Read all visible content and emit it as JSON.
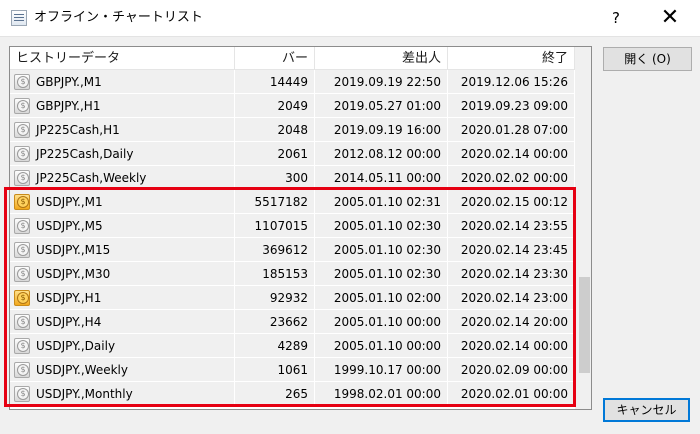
{
  "window": {
    "title": "オフライン・チャートリスト",
    "help": "?",
    "close": "✕"
  },
  "table": {
    "columns": [
      "ヒストリーデータ",
      "バー",
      "差出人",
      "終了"
    ],
    "rows": [
      {
        "symbol": "GBPJPY.,M1",
        "bars": "14449",
        "from": "2019.09.19 22:50",
        "to": "2019.12.06 15:26",
        "icon": "chart-icon"
      },
      {
        "symbol": "GBPJPY.,H1",
        "bars": "2049",
        "from": "2019.05.27 01:00",
        "to": "2019.09.23 09:00",
        "icon": "chart-icon"
      },
      {
        "symbol": "JP225Cash,H1",
        "bars": "2048",
        "from": "2019.09.19 16:00",
        "to": "2020.01.28 07:00",
        "icon": "chart-icon"
      },
      {
        "symbol": "JP225Cash,Daily",
        "bars": "2061",
        "from": "2012.08.12 00:00",
        "to": "2020.02.14 00:00",
        "icon": "chart-icon"
      },
      {
        "symbol": "JP225Cash,Weekly",
        "bars": "300",
        "from": "2014.05.11 00:00",
        "to": "2020.02.02 00:00",
        "icon": "chart-icon"
      },
      {
        "symbol": "USDJPY.,M1",
        "bars": "5517182",
        "from": "2005.01.10 02:31",
        "to": "2020.02.15 00:12",
        "icon": "chart-icon-gold"
      },
      {
        "symbol": "USDJPY.,M5",
        "bars": "1107015",
        "from": "2005.01.10 02:30",
        "to": "2020.02.14 23:55",
        "icon": "chart-icon"
      },
      {
        "symbol": "USDJPY.,M15",
        "bars": "369612",
        "from": "2005.01.10 02:30",
        "to": "2020.02.14 23:45",
        "icon": "chart-icon"
      },
      {
        "symbol": "USDJPY.,M30",
        "bars": "185153",
        "from": "2005.01.10 02:30",
        "to": "2020.02.14 23:30",
        "icon": "chart-icon"
      },
      {
        "symbol": "USDJPY.,H1",
        "bars": "92932",
        "from": "2005.01.10 02:00",
        "to": "2020.02.14 23:00",
        "icon": "chart-icon-gold"
      },
      {
        "symbol": "USDJPY.,H4",
        "bars": "23662",
        "from": "2005.01.10 00:00",
        "to": "2020.02.14 20:00",
        "icon": "chart-icon"
      },
      {
        "symbol": "USDJPY.,Daily",
        "bars": "4289",
        "from": "2005.01.10 00:00",
        "to": "2020.02.14 00:00",
        "icon": "chart-icon"
      },
      {
        "symbol": "USDJPY.,Weekly",
        "bars": "1061",
        "from": "1999.10.17 00:00",
        "to": "2020.02.09 00:00",
        "icon": "chart-icon"
      },
      {
        "symbol": "USDJPY.,Monthly",
        "bars": "265",
        "from": "1998.02.01 00:00",
        "to": "2020.02.01 00:00",
        "icon": "chart-icon"
      }
    ]
  },
  "buttons": {
    "open": "開く (O)",
    "cancel": "キャンセル"
  },
  "colors": {
    "highlight": "#e60012",
    "row_bg": "#f0f0f0",
    "cancel_border": "#0078d7"
  }
}
